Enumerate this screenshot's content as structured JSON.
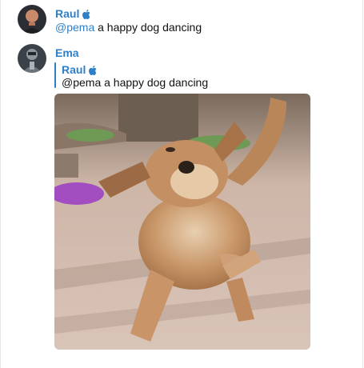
{
  "messages": [
    {
      "sender": "Raul",
      "mention": "@pema",
      "text": " a happy dog dancing"
    },
    {
      "sender": "Ema",
      "reply": {
        "sender": "Raul",
        "text": "@pema a happy dog dancing"
      },
      "attachment": "dog-photo"
    }
  ],
  "colors": {
    "accent": "#2f7fc7",
    "text": "#111111"
  },
  "icons": {
    "verified": "apple-icon"
  }
}
